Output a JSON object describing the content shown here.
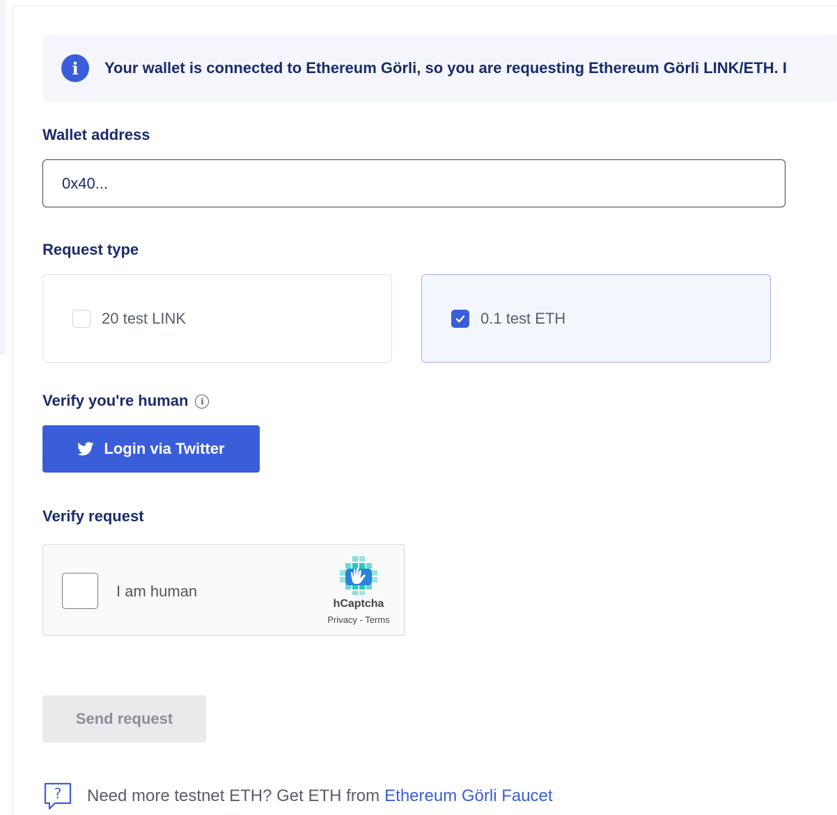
{
  "notice": {
    "icon": "info-icon",
    "text": "Your wallet is connected to Ethereum Görli, so you are requesting Ethereum Görli LINK/ETH. I"
  },
  "wallet": {
    "label": "Wallet address",
    "value": "0x40..."
  },
  "request_type": {
    "label": "Request type",
    "options": [
      {
        "label": "20 test LINK",
        "checked": false
      },
      {
        "label": "0.1 test ETH",
        "checked": true
      }
    ]
  },
  "verify_human": {
    "label": "Verify you're human",
    "info_icon": "info-circle-icon",
    "twitter_button": "Login via Twitter",
    "twitter_icon": "twitter-bird-icon"
  },
  "verify_request": {
    "label": "Verify request",
    "captcha_label": "I am human",
    "brand": "hCaptcha",
    "privacy": "Privacy",
    "separator": "-",
    "terms": "Terms"
  },
  "send_button": "Send request",
  "footer": {
    "icon": "question-chat-icon",
    "text": "Need more testnet ETH? Get ETH from",
    "link": "Ethereum Görli Faucet"
  },
  "colors": {
    "primary": "#3a5dd9",
    "heading": "#1a2b6b",
    "muted": "#565d6d",
    "notice_bg": "#f4f6fb",
    "disabled_bg": "#e9eaec"
  }
}
